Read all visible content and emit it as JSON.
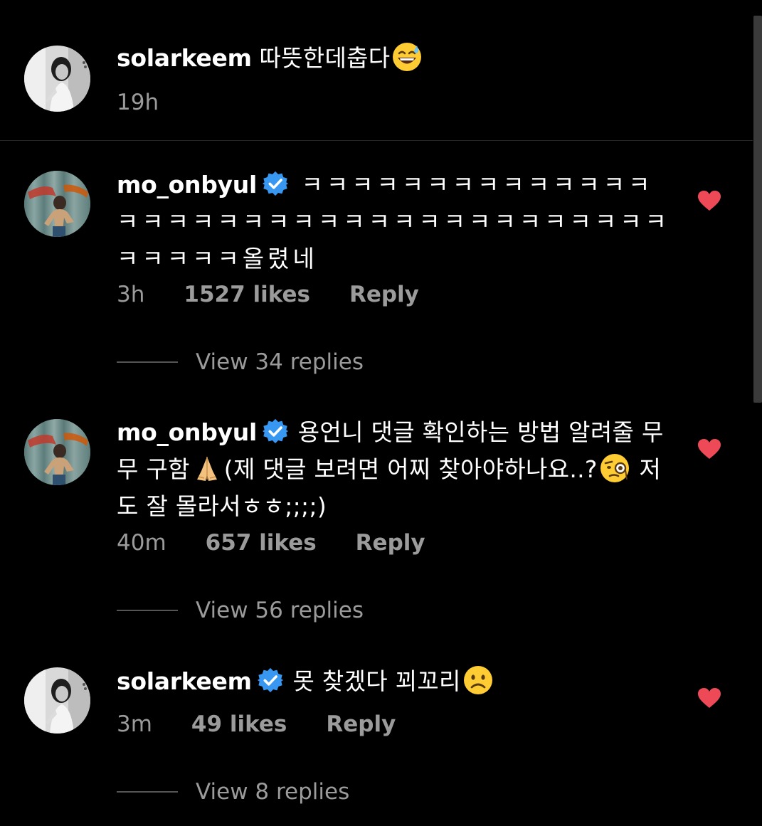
{
  "caption": {
    "username": "solarkeem",
    "text": "따뜻한데춥다",
    "emoji": "sweat-smile-emoji",
    "time": "19h"
  },
  "comments": [
    {
      "username": "mo_onbyul",
      "verified": true,
      "text": "ㅋㅋㅋㅋㅋㅋㅋㅋㅋㅋㅋㅋㅋㅋㅋㅋㅋㅋㅋㅋㅋㅋㅋㅋㅋㅋㅋㅋㅋㅋㅋㅋㅋㅋㅋㅋㅋㅋㅋㅋㅋ올렸네",
      "time": "3h",
      "likes": "1527 likes",
      "reply_label": "Reply",
      "view_replies": "View 34 replies",
      "liked": true
    },
    {
      "username": "mo_onbyul",
      "verified": true,
      "text_before": "용언니 댓글 확인하는 방법 알려줄 무무 구함",
      "emoji1": "folded-hands-emoji",
      "text_middle": "(제 댓글 보려면 어찌 찾아야하나요..?",
      "emoji2": "face-with-monocle-emoji",
      "text_after": " 저도 잘 몰라서ㅎㅎ;;;;)",
      "time": "40m",
      "likes": "657 likes",
      "reply_label": "Reply",
      "view_replies": "View 56 replies",
      "liked": true
    },
    {
      "username": "solarkeem",
      "verified": true,
      "text": "못 찾겠다 꾀꼬리",
      "emoji": "slightly-frowning-face-emoji",
      "time": "3m",
      "likes": "49 likes",
      "reply_label": "Reply",
      "view_replies": "View 8 replies",
      "liked": true
    }
  ],
  "colors": {
    "background": "#000000",
    "text": "#ffffff",
    "muted": "#9b9b9b",
    "heart": "#ed4956",
    "verified": "#3897f0"
  }
}
